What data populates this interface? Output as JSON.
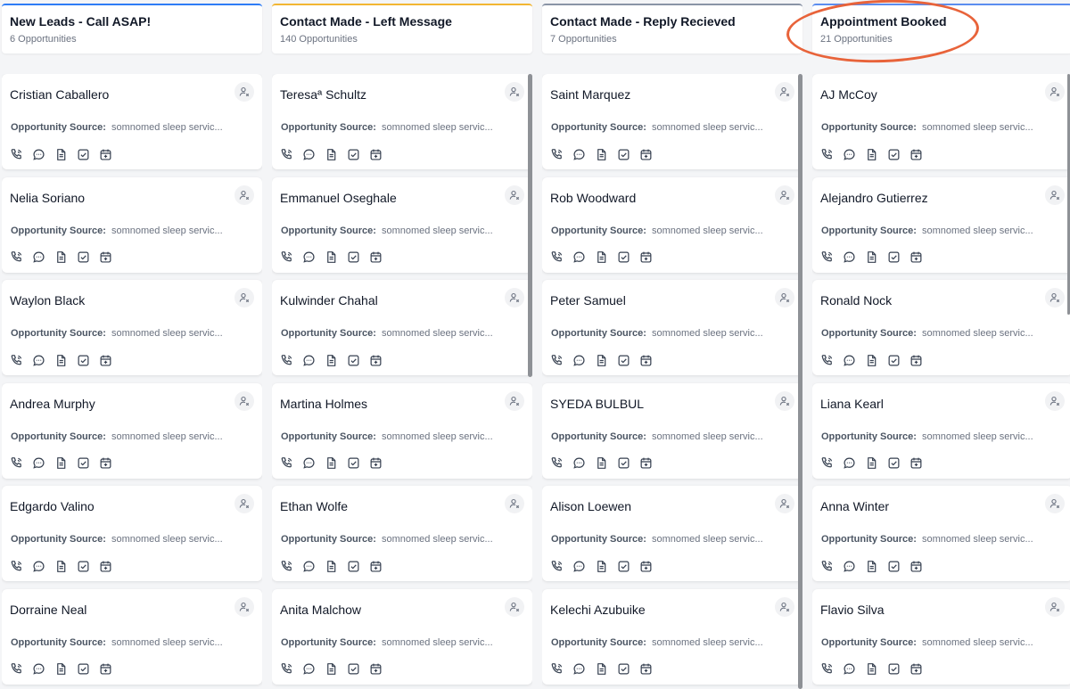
{
  "columns": [
    {
      "title": "New Leads - Call ASAP!",
      "count": "6 Opportunities",
      "cards": [
        {
          "name": "Cristian Caballero",
          "source_label": "Opportunity Source:",
          "source_value": "somnomed sleep servic..."
        },
        {
          "name": "Nelia Soriano",
          "source_label": "Opportunity Source:",
          "source_value": "somnomed sleep servic..."
        },
        {
          "name": "Waylon Black",
          "source_label": "Opportunity Source:",
          "source_value": "somnomed sleep servic..."
        },
        {
          "name": "Andrea Murphy",
          "source_label": "Opportunity Source:",
          "source_value": "somnomed sleep servic..."
        },
        {
          "name": "Edgardo Valino",
          "source_label": "Opportunity Source:",
          "source_value": "somnomed sleep servic..."
        },
        {
          "name": "Dorraine Neal",
          "source_label": "Opportunity Source:",
          "source_value": "somnomed sleep servic..."
        }
      ]
    },
    {
      "title": "Contact Made - Left Message",
      "count": "140 Opportunities",
      "cards": [
        {
          "name": "Teresaª Schultz",
          "source_label": "Opportunity Source:",
          "source_value": "somnomed sleep servic..."
        },
        {
          "name": "Emmanuel Oseghale",
          "source_label": "Opportunity Source:",
          "source_value": "somnomed sleep servic..."
        },
        {
          "name": "Kulwinder Chahal",
          "source_label": "Opportunity Source:",
          "source_value": "somnomed sleep servic..."
        },
        {
          "name": "Martina Holmes",
          "source_label": "Opportunity Source:",
          "source_value": "somnomed sleep servic..."
        },
        {
          "name": "Ethan Wolfe",
          "source_label": "Opportunity Source:",
          "source_value": "somnomed sleep servic..."
        },
        {
          "name": "Anita Malchow",
          "source_label": "Opportunity Source:",
          "source_value": "somnomed sleep servic..."
        }
      ]
    },
    {
      "title": "Contact Made - Reply Recieved",
      "count": "7 Opportunities",
      "cards": [
        {
          "name": "Saint Marquez",
          "source_label": "Opportunity Source:",
          "source_value": "somnomed sleep servic..."
        },
        {
          "name": "Rob Woodward",
          "source_label": "Opportunity Source:",
          "source_value": "somnomed sleep servic..."
        },
        {
          "name": "Peter Samuel",
          "source_label": "Opportunity Source:",
          "source_value": "somnomed sleep servic..."
        },
        {
          "name": "SYEDA BULBUL",
          "source_label": "Opportunity Source:",
          "source_value": "somnomed sleep servic..."
        },
        {
          "name": "Alison Loewen",
          "source_label": "Opportunity Source:",
          "source_value": "somnomed sleep servic..."
        },
        {
          "name": "Kelechi Azubuike",
          "source_label": "Opportunity Source:",
          "source_value": "somnomed sleep servic..."
        }
      ]
    },
    {
      "title": "Appointment Booked",
      "count": "21 Opportunities",
      "cards": [
        {
          "name": "AJ McCoy",
          "source_label": "Opportunity Source:",
          "source_value": "somnomed sleep servic..."
        },
        {
          "name": "Alejandro Gutierrez",
          "source_label": "Opportunity Source:",
          "source_value": "somnomed sleep servic..."
        },
        {
          "name": "Ronald Nock",
          "source_label": "Opportunity Source:",
          "source_value": "somnomed sleep servic..."
        },
        {
          "name": "Liana Kearl",
          "source_label": "Opportunity Source:",
          "source_value": "somnomed sleep servic..."
        },
        {
          "name": "Anna Winter",
          "source_label": "Opportunity Source:",
          "source_value": "somnomed sleep servic..."
        },
        {
          "name": "Flavio Silva",
          "source_label": "Opportunity Source:",
          "source_value": "somnomed sleep servic..."
        }
      ]
    }
  ],
  "card_icons": [
    "phone-icon",
    "chat-icon",
    "note-icon",
    "task-icon",
    "calendar-icon",
    "assign-user-icon"
  ],
  "colors": {
    "header_top_border": [
      "#2e7cf6",
      "#f2b632",
      "#8a94a6",
      "#5b8def"
    ],
    "annotation": "#e8633a",
    "icon": "#374151"
  }
}
